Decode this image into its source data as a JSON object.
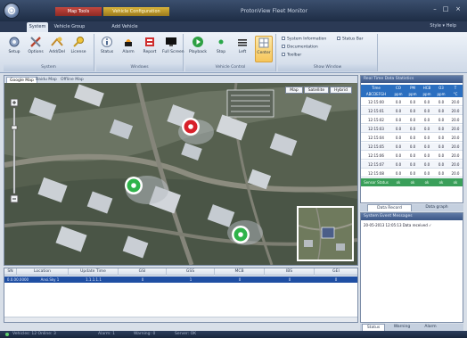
{
  "titlebar": {
    "context_tab_red": "Map Tools",
    "context_tab_yellow": "Vehicle Configuration",
    "app_title": "ProtonView Fleet Monitor",
    "minimize": "–",
    "maximize": "□",
    "close": "×",
    "help": "Style  ▾  Help"
  },
  "ribbon_tabs": [
    "System",
    "Vehicle Group",
    "Add Vehicle"
  ],
  "ribbon": {
    "groups": [
      {
        "label": "System",
        "buttons": [
          "Setup",
          "Options",
          "Add/Del",
          "License"
        ]
      },
      {
        "label": "Windows",
        "buttons": [
          "Status",
          "Alarm",
          "Report",
          "Full Screen"
        ]
      },
      {
        "label": "Vehicle Control",
        "buttons": [
          "Playback",
          "Stop",
          "Left",
          "Center"
        ]
      },
      {
        "label": "Show Window",
        "buttons": []
      }
    ],
    "checks": [
      "System Information",
      "Documentation",
      "Toolbar"
    ],
    "status_bar_label": "Status Bar"
  },
  "map": {
    "tabs": [
      "Google Map",
      "Baidu Map",
      "Offline Map"
    ],
    "overlay_buttons": [
      "Map",
      "Satellite",
      "Hybrid"
    ],
    "markers": [
      {
        "status": "alarm",
        "color": "#d8202a"
      },
      {
        "status": "online",
        "color": "#2fb34a"
      },
      {
        "status": "online",
        "color": "#2fb34a"
      }
    ]
  },
  "grid": {
    "columns": [
      "SN",
      "Location",
      "Update Time",
      "GSI",
      "GSS",
      "MCB",
      "IBS",
      "GEI"
    ],
    "row": [
      "0.0.00.0000",
      "Ansi.Sky 1",
      "1.1.1.1.1",
      "0",
      "1",
      "0",
      "0",
      "0"
    ]
  },
  "data_panel": {
    "caption": "Real Time Data Statistics",
    "header_top": [
      "Time",
      "CO",
      "PM",
      "HCB",
      "O3",
      "T"
    ],
    "header_bottom": [
      "ABCDEFGH",
      "ppm",
      "ppm",
      "ppm",
      "ppm",
      "°C"
    ],
    "rows": [
      [
        "12:15:00",
        "0.0",
        "0.0",
        "0.0",
        "0.0",
        "20.0"
      ],
      [
        "12:15:01",
        "0.0",
        "0.0",
        "0.0",
        "0.0",
        "20.0"
      ],
      [
        "12:15:02",
        "0.0",
        "0.0",
        "0.0",
        "0.0",
        "20.0"
      ],
      [
        "12:15:03",
        "0.0",
        "0.0",
        "0.0",
        "0.0",
        "20.0"
      ],
      [
        "12:15:04",
        "0.0",
        "0.0",
        "0.0",
        "0.0",
        "20.0"
      ],
      [
        "12:15:05",
        "0.0",
        "0.0",
        "0.0",
        "0.0",
        "20.0"
      ],
      [
        "12:15:06",
        "0.0",
        "0.0",
        "0.0",
        "0.0",
        "20.0"
      ],
      [
        "12:15:07",
        "0.0",
        "0.0",
        "0.0",
        "0.0",
        "20.0"
      ],
      [
        "12:15:08",
        "0.0",
        "0.0",
        "0.0",
        "0.0",
        "20.0"
      ]
    ],
    "footer": [
      "Sensor Status",
      "ok",
      "ok",
      "ok",
      "ok",
      "ok"
    ],
    "tabs": [
      "Data Record",
      "Data graph"
    ]
  },
  "log_panel": {
    "caption": "System Event Messages",
    "line": "20-05-2013 12:05:13  Data received ✓",
    "tabs": [
      "Status",
      "Warning",
      "Alarm"
    ]
  },
  "statusbar": {
    "items": [
      "Vehicles: 12  Online: 3",
      "Alarm: 1",
      "Warning: 0",
      "Server: OK"
    ]
  }
}
